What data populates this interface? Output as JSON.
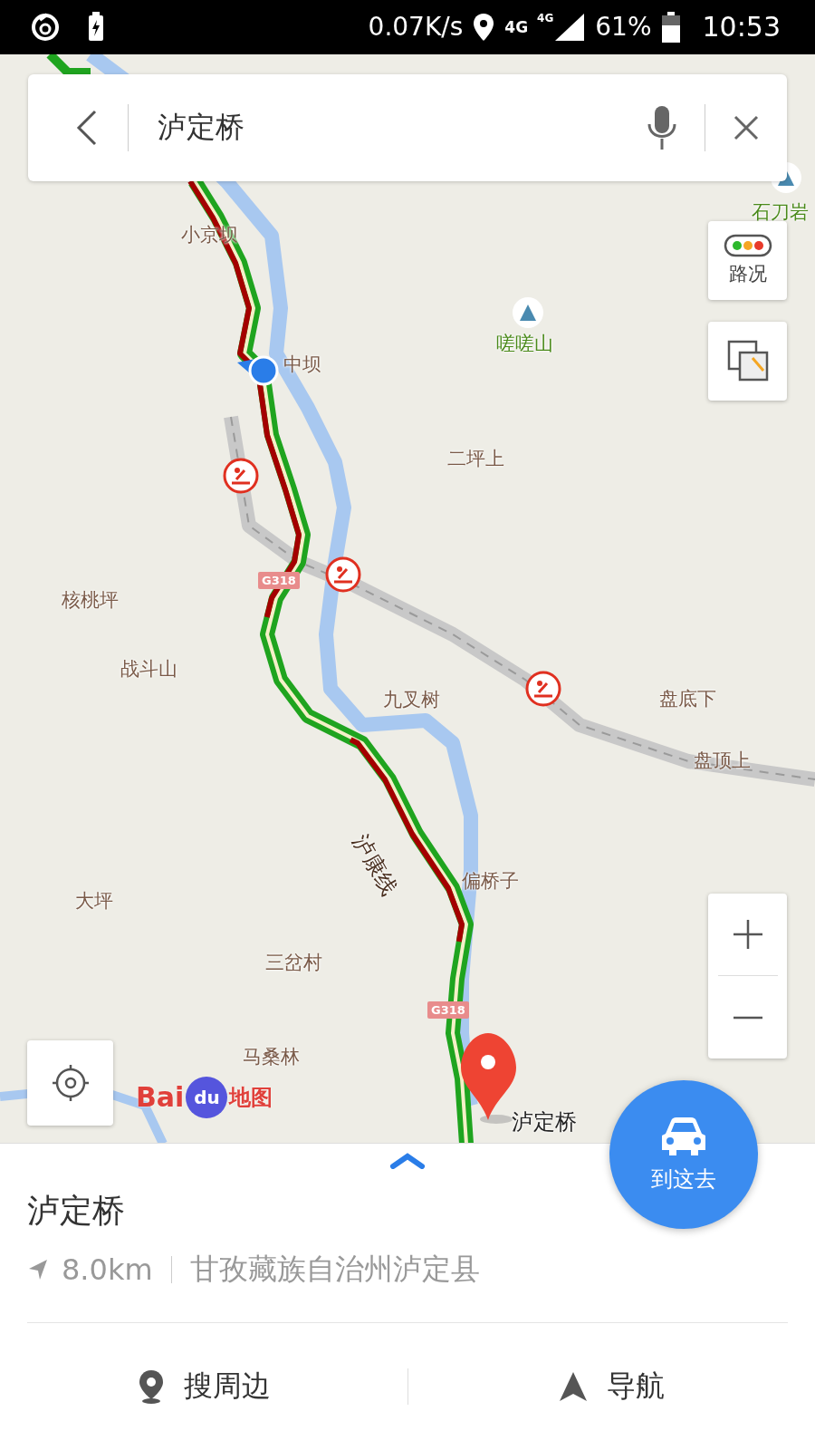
{
  "status_bar": {
    "speed": "0.07K/s",
    "data_network": "4G",
    "signal_network": "4G",
    "battery": "61%",
    "time": "10:53"
  },
  "search": {
    "value": "泸定桥"
  },
  "map": {
    "labels": [
      {
        "text": "石刀岩",
        "kind": "peak"
      },
      {
        "text": "小京坝",
        "kind": "place"
      },
      {
        "text": "嗟嗟山",
        "kind": "peak"
      },
      {
        "text": "中坝",
        "kind": "place"
      },
      {
        "text": "二坪上",
        "kind": "place"
      },
      {
        "text": "G318",
        "kind": "highway"
      },
      {
        "text": "核桃坪",
        "kind": "place"
      },
      {
        "text": "战斗山",
        "kind": "place"
      },
      {
        "text": "九叉树",
        "kind": "place"
      },
      {
        "text": "盘底下",
        "kind": "place"
      },
      {
        "text": "盘顶上",
        "kind": "place"
      },
      {
        "text": "泸康线",
        "kind": "road"
      },
      {
        "text": "偏桥子",
        "kind": "place"
      },
      {
        "text": "大坪",
        "kind": "place"
      },
      {
        "text": "三岔村",
        "kind": "place"
      },
      {
        "text": "G318",
        "kind": "highway"
      },
      {
        "text": "马桑林",
        "kind": "place"
      },
      {
        "text": "泸定桥",
        "kind": "destination"
      }
    ],
    "traffic_button": "路况",
    "logo": {
      "latin_1": "Bai",
      "latin_2": "du",
      "chinese": "地图"
    }
  },
  "place": {
    "name": "泸定桥",
    "distance": "8.0km",
    "address": "甘孜藏族自治州泸定县"
  },
  "go_button": "到这去",
  "actions": [
    {
      "label": "搜周边",
      "kind": "nearby"
    },
    {
      "label": "导航",
      "kind": "navigate"
    }
  ]
}
